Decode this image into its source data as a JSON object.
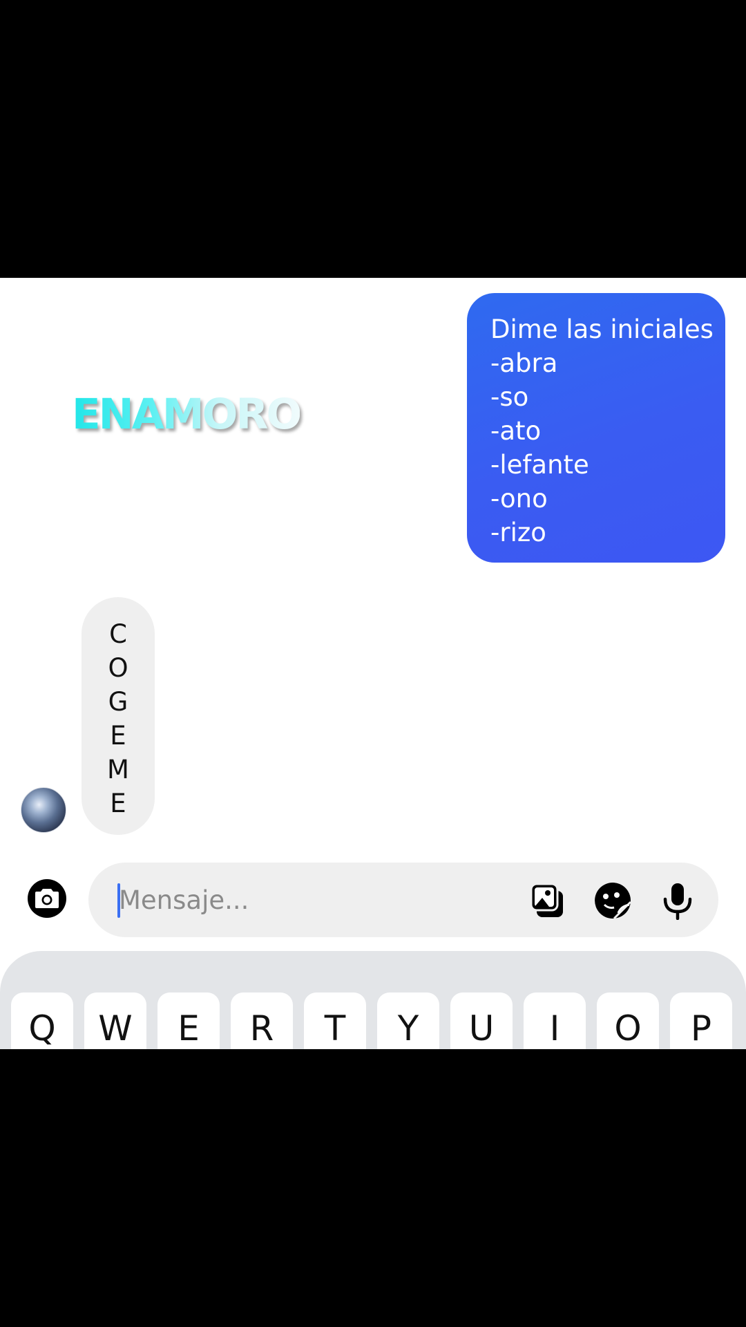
{
  "chat": {
    "sent_message": {
      "lines": [
        "Dime las iniciales",
        "-abra",
        "-so",
        "-ato",
        "-lefante",
        "-ono",
        "-rizo"
      ]
    },
    "sticker": {
      "text": "ENAMORO"
    },
    "received_message": {
      "letters": [
        "C",
        "O",
        "G",
        "E",
        "M",
        "E"
      ]
    }
  },
  "composer": {
    "placeholder": "Mensaje...",
    "value": "",
    "icons": {
      "camera": "camera-icon",
      "gallery": "gallery-icon",
      "sticker": "sticker-icon",
      "microphone": "microphone-icon"
    }
  },
  "keyboard": {
    "row1": [
      "Q",
      "W",
      "E",
      "R",
      "T",
      "Y",
      "U",
      "I",
      "O",
      "P"
    ]
  },
  "colors": {
    "sent_bubble": "#3a5cf2",
    "received_bubble": "#efefef",
    "keyboard_bg": "#e3e5e8",
    "caret": "#3a6ff3"
  }
}
